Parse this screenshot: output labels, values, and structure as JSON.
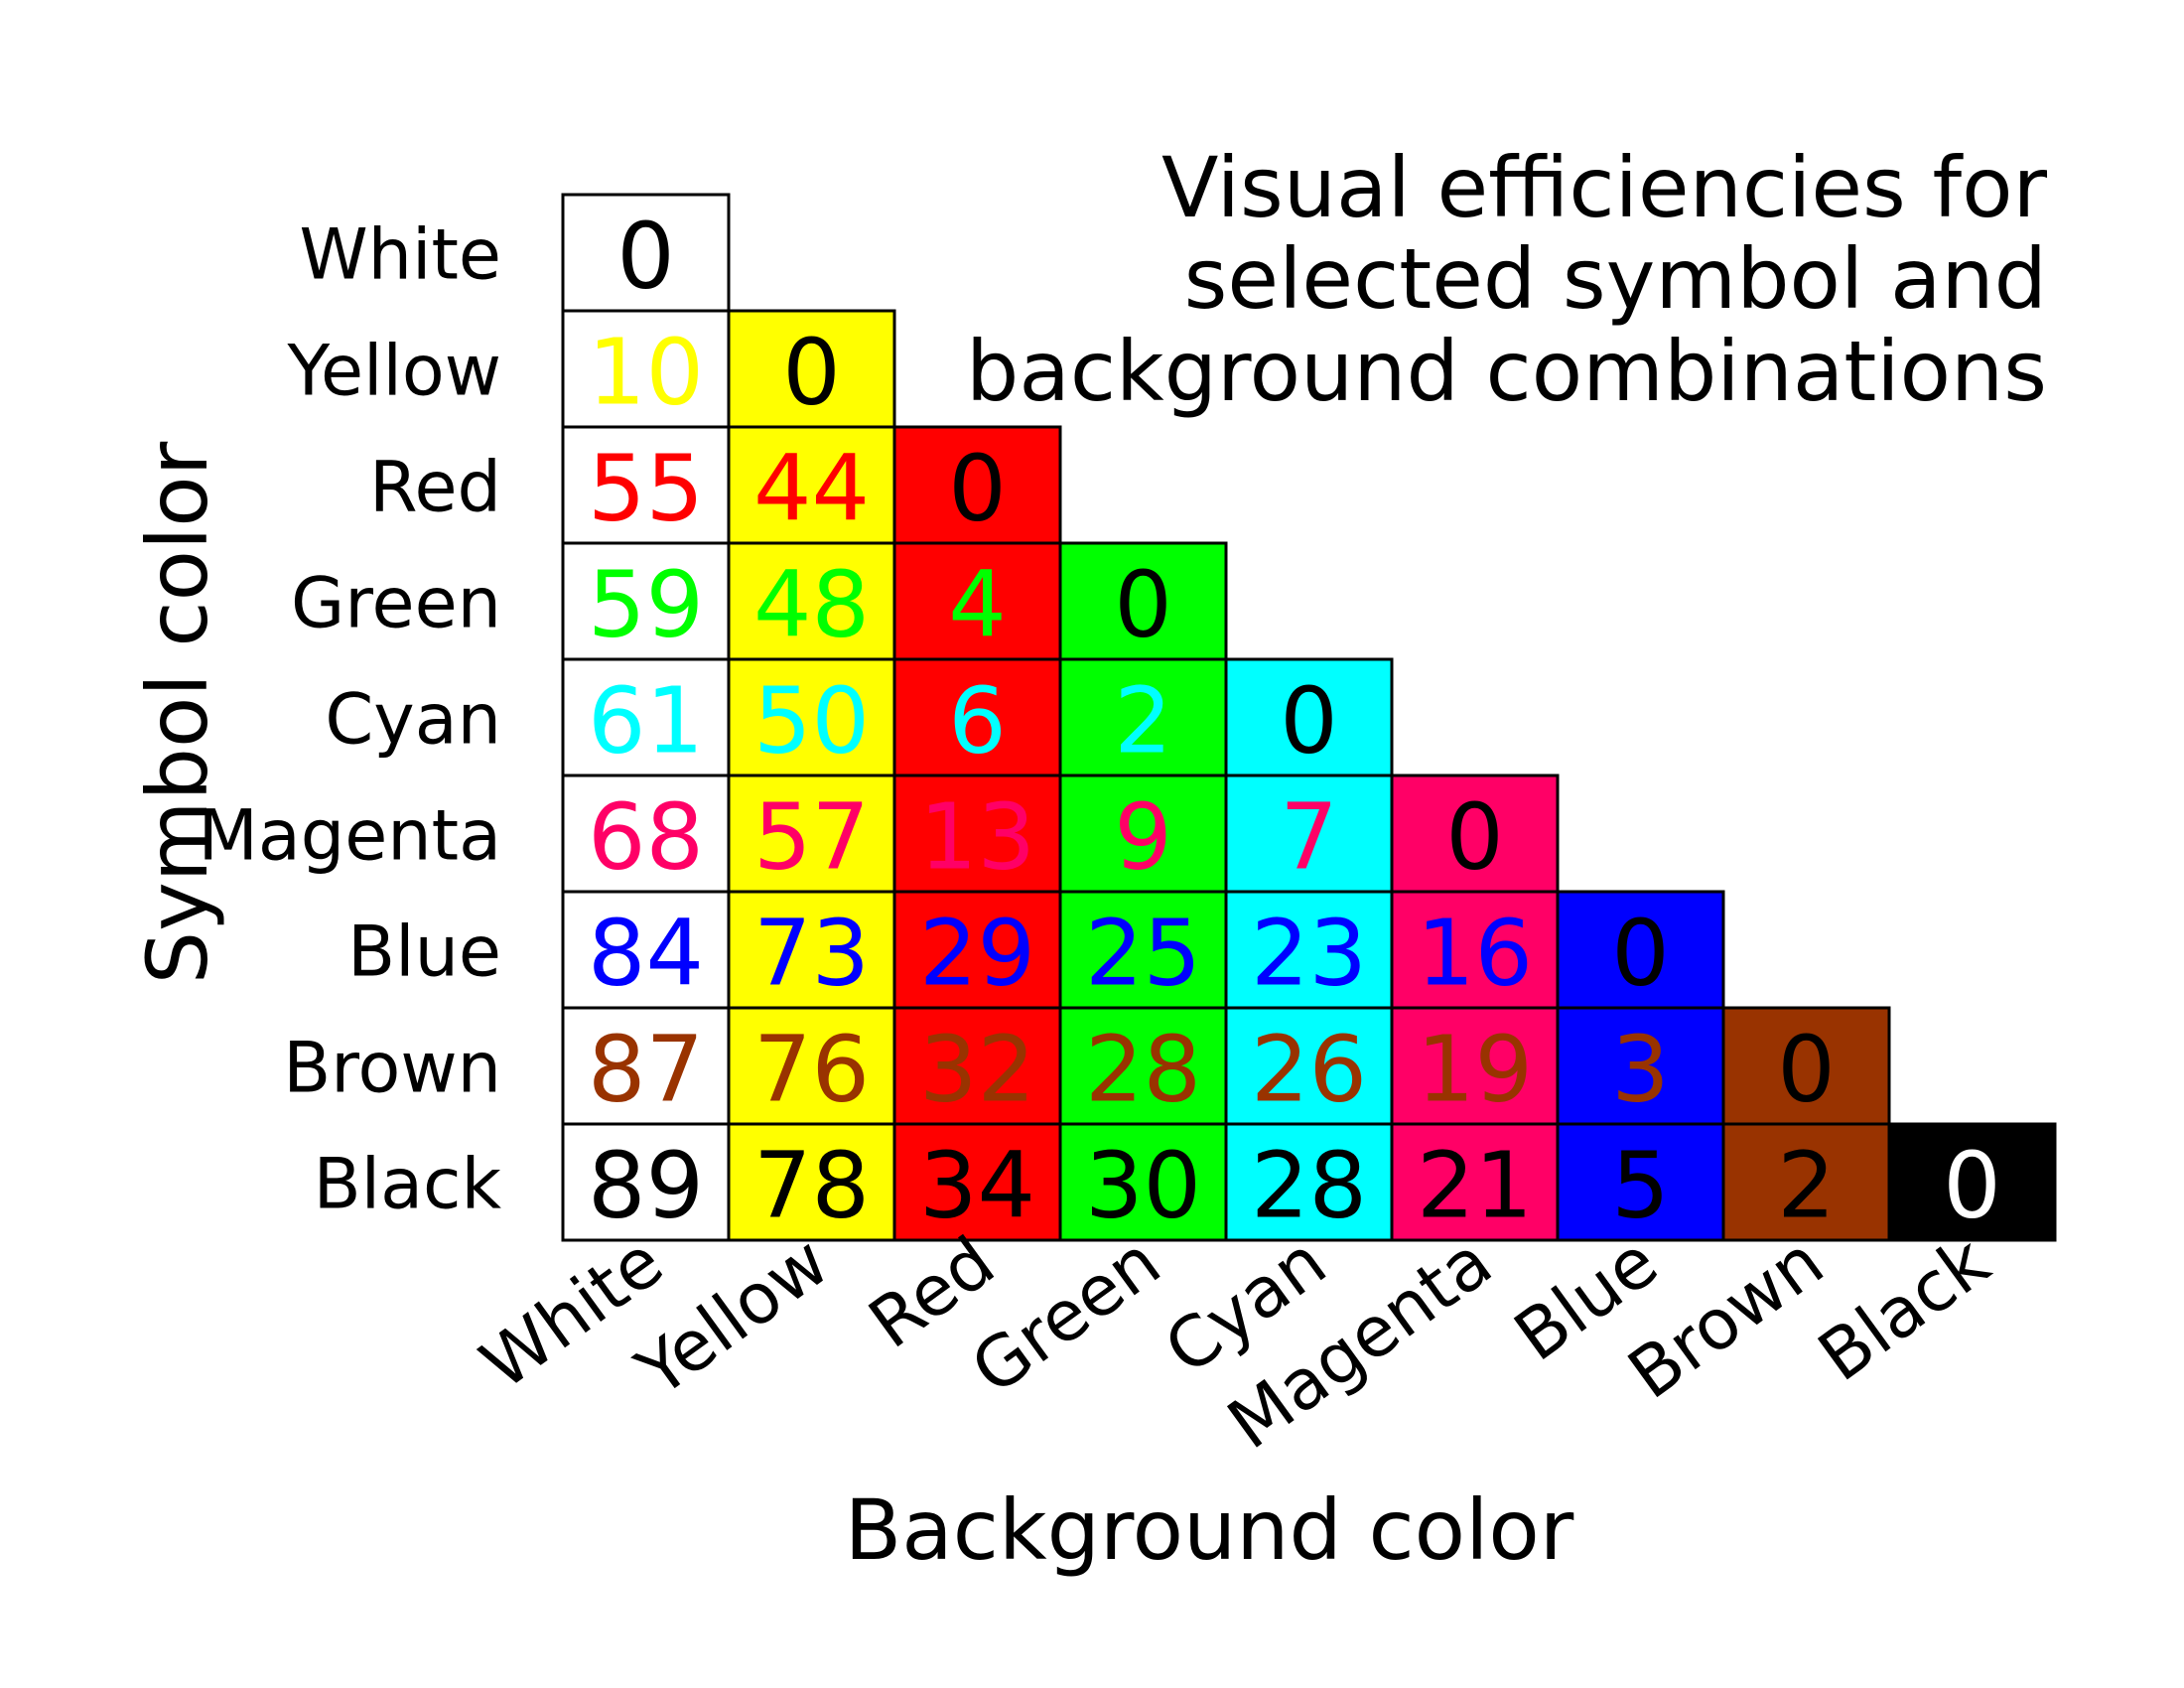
{
  "chart_data": {
    "type": "heatmap",
    "title_lines": [
      "Visual efficiencies for",
      "selected symbol and",
      "background combinations"
    ],
    "xlabel": "Background color",
    "ylabel": "Symbol color",
    "x_categories": [
      "White",
      "Yellow",
      "Red",
      "Green",
      "Cyan",
      "Magenta",
      "Blue",
      "Brown",
      "Black"
    ],
    "y_categories": [
      "White",
      "Yellow",
      "Red",
      "Green",
      "Cyan",
      "Magenta",
      "Blue",
      "Brown",
      "Black"
    ],
    "colors": {
      "White": "#ffffff",
      "Yellow": "#ffff00",
      "Red": "#ff0000",
      "Green": "#00ff00",
      "Cyan": "#00ffff",
      "Magenta": "#ff0066",
      "Blue": "#0000ff",
      "Brown": "#993300",
      "Black": "#000000"
    },
    "diagonal_text_color": "#000000",
    "black_diagonal_text_color": "#ffffff",
    "values": [
      [
        0
      ],
      [
        10,
        0
      ],
      [
        55,
        44,
        0
      ],
      [
        59,
        48,
        4,
        0
      ],
      [
        61,
        50,
        6,
        2,
        0
      ],
      [
        68,
        57,
        13,
        9,
        7,
        0
      ],
      [
        84,
        73,
        29,
        25,
        23,
        16,
        0
      ],
      [
        87,
        76,
        32,
        28,
        26,
        19,
        3,
        0
      ],
      [
        89,
        78,
        34,
        30,
        28,
        21,
        5,
        2,
        0
      ]
    ]
  }
}
